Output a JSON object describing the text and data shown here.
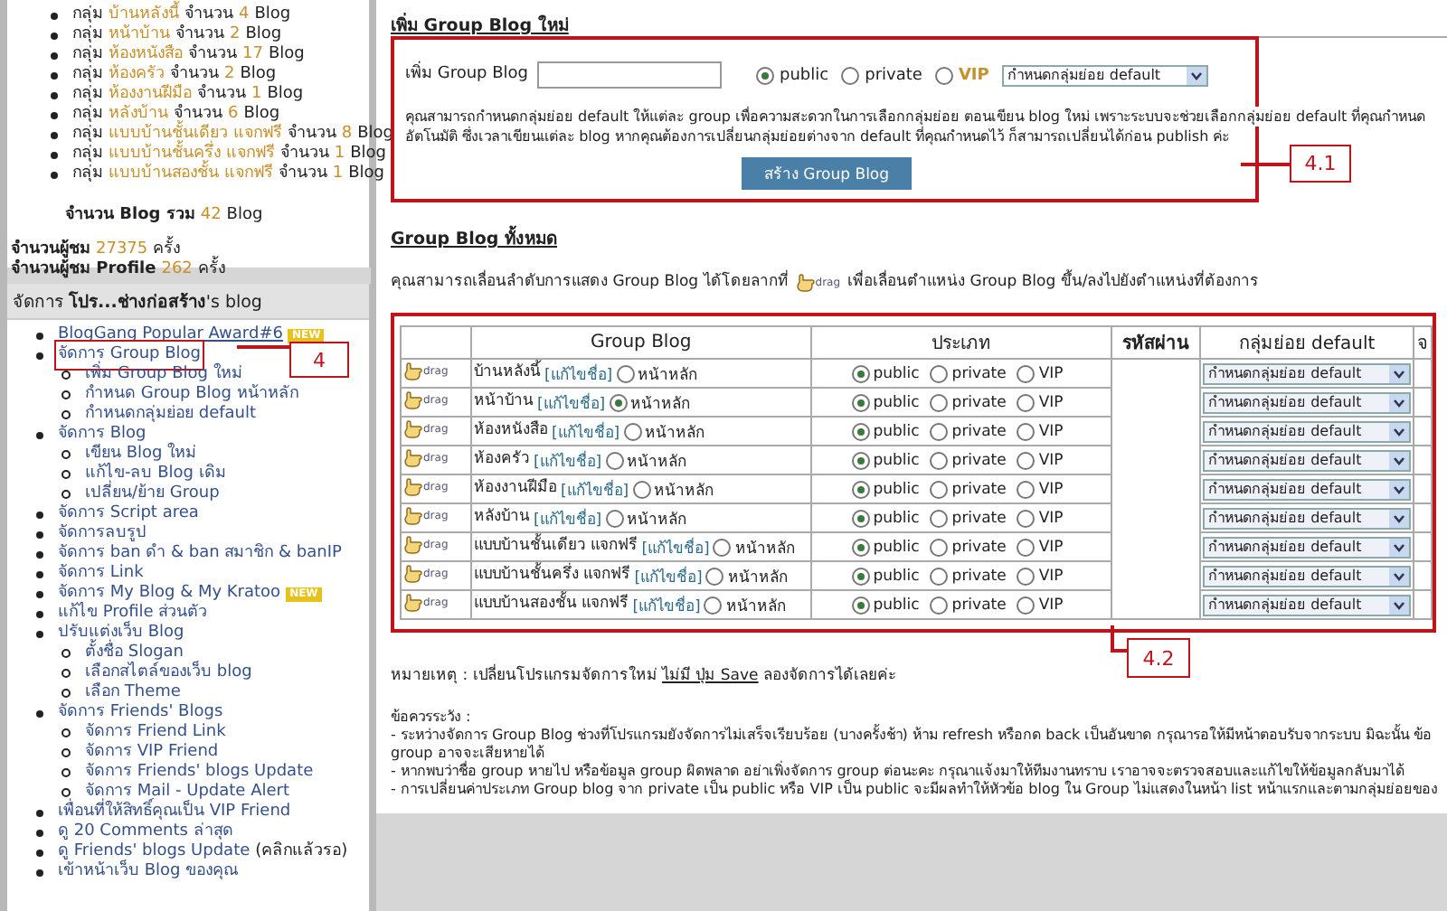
{
  "group_summary": {
    "items": [
      {
        "prefix": "กลุ่ม",
        "name": "บ้านหลังนี้",
        "count_label": "จำนวน",
        "count": "4",
        "unit": "Blog"
      },
      {
        "prefix": "กลุ่ม",
        "name": "หน้าบ้าน",
        "count_label": "จำนวน",
        "count": "2",
        "unit": "Blog"
      },
      {
        "prefix": "กลุ่ม",
        "name": "ห้องหนังสือ",
        "count_label": "จำนวน",
        "count": "17",
        "unit": "Blog"
      },
      {
        "prefix": "กลุ่ม",
        "name": "ห้องครัว",
        "count_label": "จำนวน",
        "count": "2",
        "unit": "Blog"
      },
      {
        "prefix": "กลุ่ม",
        "name": "ห้องงานฝีมือ",
        "count_label": "จำนวน",
        "count": "1",
        "unit": "Blog"
      },
      {
        "prefix": "กลุ่ม",
        "name": "หลังบ้าน",
        "count_label": "จำนวน",
        "count": "6",
        "unit": "Blog"
      },
      {
        "prefix": "กลุ่ม",
        "name": "แบบบ้านชั้นเดียว แจกฟรี",
        "count_label": "จำนวน",
        "count": "8",
        "unit": "Blog"
      },
      {
        "prefix": "กลุ่ม",
        "name": "แบบบ้านชั้นครึ่ง แจกฟรี",
        "count_label": "จำนวน",
        "count": "1",
        "unit": "Blog"
      },
      {
        "prefix": "กลุ่ม",
        "name": "แบบบ้านสองชั้น แจกฟรี",
        "count_label": "จำนวน",
        "count": "1",
        "unit": "Blog"
      }
    ],
    "total": {
      "label": "จำนวน Blog รวม",
      "value": "42",
      "unit": "Blog"
    },
    "stats": [
      {
        "label": "จำนวนผู้ชม",
        "value": "27375",
        "unit": "ครั้ง"
      },
      {
        "label": "จำนวนผู้ชม Profile",
        "value": "262",
        "unit": "ครั้ง"
      }
    ]
  },
  "manage_menu": {
    "title": "จัดการ **โปร...ช่างก่อสร้าง**'s blog",
    "items": [
      {
        "label": "BlogGang Popular Award#6",
        "badge": "NEW",
        "underlined": true
      },
      {
        "label": "จัดการ Group Blog",
        "callout": "4",
        "children": [
          {
            "label": "เพิ่ม Group Blog ใหม่"
          },
          {
            "label": "กำหนด Group Blog หน้าหลัก"
          },
          {
            "label": "กำหนดกลุ่มย่อย default"
          }
        ]
      },
      {
        "label": "จัดการ Blog",
        "children": [
          {
            "label": "เขียน Blog ใหม่"
          },
          {
            "label": "แก้ไข-ลบ Blog เดิม"
          },
          {
            "label": "เปลี่ยน/ย้าย Group"
          }
        ]
      },
      {
        "label": "จัดการ Script area"
      },
      {
        "label": "จัดการลบรูป"
      },
      {
        "label": "จัดการ ban ดำ & ban สมาชิก & banIP"
      },
      {
        "label": "จัดการ Link"
      },
      {
        "label": "จัดการ My Blog & My Kratoo",
        "badge": "NEW"
      },
      {
        "label": "แก้ไข Profile ส่วนตัว"
      },
      {
        "label": "ปรับแต่งเว็บ Blog",
        "children": [
          {
            "label": "ตั้งชื่อ Slogan"
          },
          {
            "label": "เลือกสไตล์ของเว็บ blog"
          },
          {
            "label": "เลือก Theme"
          }
        ]
      },
      {
        "label": "จัดการ Friends' Blogs",
        "children": [
          {
            "label": "จัดการ Friend Link"
          },
          {
            "label": "จัดการ VIP Friend"
          },
          {
            "label": "จัดการ Friends' blogs Update"
          },
          {
            "label": "จัดการ Mail - Update Alert"
          }
        ]
      },
      {
        "label": "เพื่อนที่ให้สิทธิ์คุณเป็น VIP Friend"
      },
      {
        "label": "ดู 20 Comments ล่าสุด"
      },
      {
        "label": "ดู Friends' blogs Update",
        "note": "(คลิกแล้วรอ)"
      },
      {
        "label": "เข้าหน้าเว็บ Blog ของคุณ"
      }
    ]
  },
  "new_group": {
    "heading": "เพิ่ม Group Blog ใหม่",
    "callout": "4.1",
    "field_label": "เพิ่ม Group Blog",
    "visibility": [
      {
        "label": "public",
        "selected": true
      },
      {
        "label": "private",
        "selected": false
      },
      {
        "label": "VIP",
        "selected": false,
        "color": "#c8902c"
      }
    ],
    "subgroup_select": "กำหนดกลุ่มย่อย default",
    "help": [
      "คุณสามารถกำหนดกลุ่มย่อย default ให้แต่ละ group เพื่อความสะดวกในการเลือกกลุ่มย่อย ตอนเขียน blog ใหม่ เพราะระบบจะช่วยเลือกกลุ่มย่อย default ที่คุณกำหนด",
      "อัตโนมัติ ซึ่งเวลาเขียนแต่ละ blog หากคุณต้องการเปลี่ยนกลุ่มย่อยต่างจาก default ที่คุณกำหนดไว้ ก็สามารถเปลี่ยนได้ก่อน publish ค่ะ"
    ],
    "submit": "สร้าง Group Blog"
  },
  "all_groups": {
    "heading": "Group Blog ทั้งหมด",
    "intro_before": "คุณสามารถเลื่อนลำดับการแสดง Group Blog ได้โดยลากที่",
    "intro_drag": "drag",
    "intro_after": "เพื่อเลื่อนตำแหน่ง Group Blog ขึ้น/ลงไปยังตำแหน่งที่ต้องการ",
    "callout": "4.2",
    "columns": [
      "Group Blog",
      "ประเภท",
      "รหัสผ่าน",
      "กลุ่มย่อย default",
      "จ"
    ],
    "rows": [
      {
        "handle": "drag",
        "name": "บ้านหลังนี้",
        "edit_link": "[แก้ไขชื่อ]",
        "home_label": "หน้าหลัก",
        "home": false,
        "types": [
          {
            "label": "public",
            "selected": true
          },
          {
            "label": "private",
            "selected": false
          },
          {
            "label": "VIP",
            "selected": false
          }
        ],
        "subgroup": "กำหนดกลุ่มย่อย default"
      },
      {
        "handle": "drag",
        "name": "หน้าบ้าน",
        "edit_link": "[แก้ไขชื่อ]",
        "home_label": "หน้าหลัก",
        "home": true,
        "types": [
          {
            "label": "public",
            "selected": true
          },
          {
            "label": "private",
            "selected": false
          },
          {
            "label": "VIP",
            "selected": false
          }
        ],
        "subgroup": "กำหนดกลุ่มย่อย default"
      },
      {
        "handle": "drag",
        "name": "ห้องหนังสือ",
        "edit_link": "[แก้ไขชื่อ]",
        "home_label": "หน้าหลัก",
        "home": false,
        "types": [
          {
            "label": "public",
            "selected": true
          },
          {
            "label": "private",
            "selected": false
          },
          {
            "label": "VIP",
            "selected": false
          }
        ],
        "subgroup": "กำหนดกลุ่มย่อย default"
      },
      {
        "handle": "drag",
        "name": "ห้องครัว",
        "edit_link": "[แก้ไขชื่อ]",
        "home_label": "หน้าหลัก",
        "home": false,
        "types": [
          {
            "label": "public",
            "selected": true
          },
          {
            "label": "private",
            "selected": false
          },
          {
            "label": "VIP",
            "selected": false
          }
        ],
        "subgroup": "กำหนดกลุ่มย่อย default"
      },
      {
        "handle": "drag",
        "name": "ห้องงานฝีมือ",
        "edit_link": "[แก้ไขชื่อ]",
        "home_label": "หน้าหลัก",
        "home": false,
        "types": [
          {
            "label": "public",
            "selected": true
          },
          {
            "label": "private",
            "selected": false
          },
          {
            "label": "VIP",
            "selected": false
          }
        ],
        "subgroup": "กำหนดกลุ่มย่อย default"
      },
      {
        "handle": "drag",
        "name": "หลังบ้าน",
        "edit_link": "[แก้ไขชื่อ]",
        "home_label": "หน้าหลัก",
        "home": false,
        "types": [
          {
            "label": "public",
            "selected": true
          },
          {
            "label": "private",
            "selected": false
          },
          {
            "label": "VIP",
            "selected": false
          }
        ],
        "subgroup": "กำหนดกลุ่มย่อย default"
      },
      {
        "handle": "drag",
        "name": "แบบบ้านชั้นเดียว แจกฟรี",
        "edit_link": "[แก้ไขชื่อ]",
        "home_label": "หน้าหลัก",
        "home": false,
        "types": [
          {
            "label": "public",
            "selected": true
          },
          {
            "label": "private",
            "selected": false
          },
          {
            "label": "VIP",
            "selected": false
          }
        ],
        "subgroup": "กำหนดกลุ่มย่อย default"
      },
      {
        "handle": "drag",
        "name": "แบบบ้านชั้นครึ่ง แจกฟรี",
        "edit_link": "[แก้ไขชื่อ]",
        "home_label": "หน้าหลัก",
        "home": false,
        "types": [
          {
            "label": "public",
            "selected": true
          },
          {
            "label": "private",
            "selected": false
          },
          {
            "label": "VIP",
            "selected": false
          }
        ],
        "subgroup": "กำหนดกลุ่มย่อย default"
      },
      {
        "handle": "drag",
        "name": "แบบบ้านสองชั้น แจกฟรี",
        "edit_link": "[แก้ไขชื่อ]",
        "home_label": "หน้าหลัก",
        "home": false,
        "types": [
          {
            "label": "public",
            "selected": true
          },
          {
            "label": "private",
            "selected": false
          },
          {
            "label": "VIP",
            "selected": false
          }
        ],
        "subgroup": "กำหนดกลุ่มย่อย default"
      }
    ]
  },
  "notes": {
    "remark_before": "หมายเหตุ : เปลี่ยนโปรแกรมจัดการใหม่",
    "remark_link": "ไม่มี ปุ่ม Save",
    "remark_after": "ลองจัดการได้เลยค่ะ",
    "caution_title": "ข้อควรระวัง :",
    "cautions": [
      {
        "lines": [
          "- ระหว่างจัดการ Group Blog ช่วงที่โปรแกรมยังจัดการไม่เสร็จเรียบร้อย (บางครั้งช้า) ห้าม refresh หรือกด back เป็นอันขาด กรุณารอให้มีหน้าตอบรับจากระบบ มิฉะนั้น ข้อ",
          "group อาจจะเสียหายได้"
        ]
      },
      {
        "lines": [
          "- หากพบว่าชื่อ group หายไป หรือข้อมูล group ผิดพลาด อย่าเพิ่งจัดการ group ต่อนะคะ กรุณาแจ้งมาให้ทีมงานทราบ เราอาจจะตรวจสอบและแก้ไขให้ข้อมูลกลับมาได้"
        ]
      },
      {
        "lines": [
          "- การเปลี่ยนค่าประเภท Group blog จาก private เป็น public หรือ VIP เป็น public จะมีผลทำให้หัวข้อ blog ใน Group ไม่แสดงในหน้า list หน้าแรกและตามกลุ่มย่อยของ"
        ]
      }
    ]
  }
}
